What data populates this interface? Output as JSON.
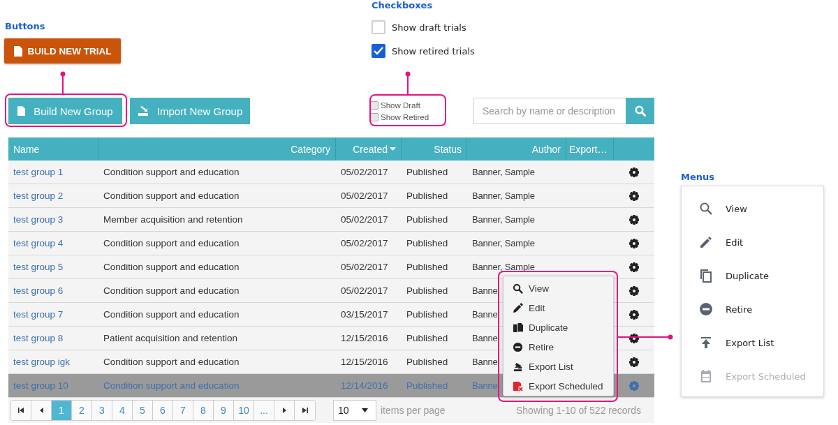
{
  "buttons_section": {
    "heading": "Buttons",
    "primary_button": "BUILD NEW TRIAL"
  },
  "checkboxes_section": {
    "heading": "Checkboxes",
    "items": [
      {
        "label": "Show draft trials",
        "checked": false
      },
      {
        "label": "Show retired trials",
        "checked": true
      }
    ]
  },
  "toolbar": {
    "buttons": [
      "Build New Group",
      "Import New Group"
    ],
    "filters": [
      {
        "label": "Show Draft",
        "checked": false
      },
      {
        "label": "Show Retired",
        "checked": false
      }
    ],
    "search": {
      "placeholder": "Search by name or description"
    }
  },
  "table": {
    "columns": [
      {
        "label": "Name",
        "sorted": false
      },
      {
        "label": "Category",
        "sorted": false
      },
      {
        "label": "Created",
        "sorted": true
      },
      {
        "label": "Status",
        "sorted": false
      },
      {
        "label": "Author",
        "sorted": false
      },
      {
        "label": "Export…",
        "sorted": false
      }
    ],
    "rows": [
      {
        "name": "test group 1",
        "category": "Condition support and education",
        "created": "05/02/2017",
        "status": "Published",
        "author": "Banner, Sample",
        "selected": false
      },
      {
        "name": "test group 2",
        "category": "Condition support and education",
        "created": "05/02/2017",
        "status": "Published",
        "author": "Banner, Sample",
        "selected": false
      },
      {
        "name": "test group 3",
        "category": "Member acquisition and retention",
        "created": "05/02/2017",
        "status": "Published",
        "author": "Banner, Sample",
        "selected": false
      },
      {
        "name": "test group 4",
        "category": "Condition support and education",
        "created": "05/02/2017",
        "status": "Published",
        "author": "Banner, Sample",
        "selected": false
      },
      {
        "name": "test group 5",
        "category": "Condition support and education",
        "created": "05/02/2017",
        "status": "Published",
        "author": "Banner, Sample",
        "selected": false
      },
      {
        "name": "test group 6",
        "category": "Condition support and education",
        "created": "05/02/2017",
        "status": "Published",
        "author": "Banne",
        "selected": false
      },
      {
        "name": "test group 7",
        "category": "Condition support and education",
        "created": "03/15/2017",
        "status": "Published",
        "author": "Banne",
        "selected": false
      },
      {
        "name": "test group 8",
        "category": "Patient acquisition and retention",
        "created": "12/15/2016",
        "status": "Published",
        "author": "Banne",
        "selected": false
      },
      {
        "name": "test group igk",
        "category": "Condition support and education",
        "created": "12/15/2016",
        "status": "Published",
        "author": "Banne",
        "selected": false
      },
      {
        "name": "test group 10",
        "category": "Condition support and education",
        "created": "12/14/2016",
        "status": "Published",
        "author": "Banne",
        "selected": true
      }
    ]
  },
  "pagination": {
    "pages": [
      {
        "label": "1",
        "selected": true
      },
      {
        "label": "2",
        "selected": false
      },
      {
        "label": "3",
        "selected": false
      },
      {
        "label": "4",
        "selected": false
      },
      {
        "label": "5",
        "selected": false
      },
      {
        "label": "6",
        "selected": false
      },
      {
        "label": "7",
        "selected": false
      },
      {
        "label": "8",
        "selected": false
      },
      {
        "label": "9",
        "selected": false
      },
      {
        "label": "10",
        "selected": false
      },
      {
        "label": "...",
        "selected": false
      }
    ],
    "page_size": "10",
    "page_size_label": "items per page",
    "summary": "Showing 1-10 of 522 records"
  },
  "context_menu": {
    "items": [
      {
        "label": "View"
      },
      {
        "label": "Edit"
      },
      {
        "label": "Duplicate"
      },
      {
        "label": "Retire"
      },
      {
        "label": "Export List"
      },
      {
        "label": "Export Scheduled"
      }
    ]
  },
  "menus_section": {
    "heading": "Menus",
    "items": [
      {
        "label": "View",
        "disabled": false
      },
      {
        "label": "Edit",
        "disabled": false
      },
      {
        "label": "Duplicate",
        "disabled": false
      },
      {
        "label": "Retire",
        "disabled": false
      },
      {
        "label": "Export List",
        "disabled": false
      },
      {
        "label": "Export Scheduled",
        "disabled": true
      }
    ]
  }
}
